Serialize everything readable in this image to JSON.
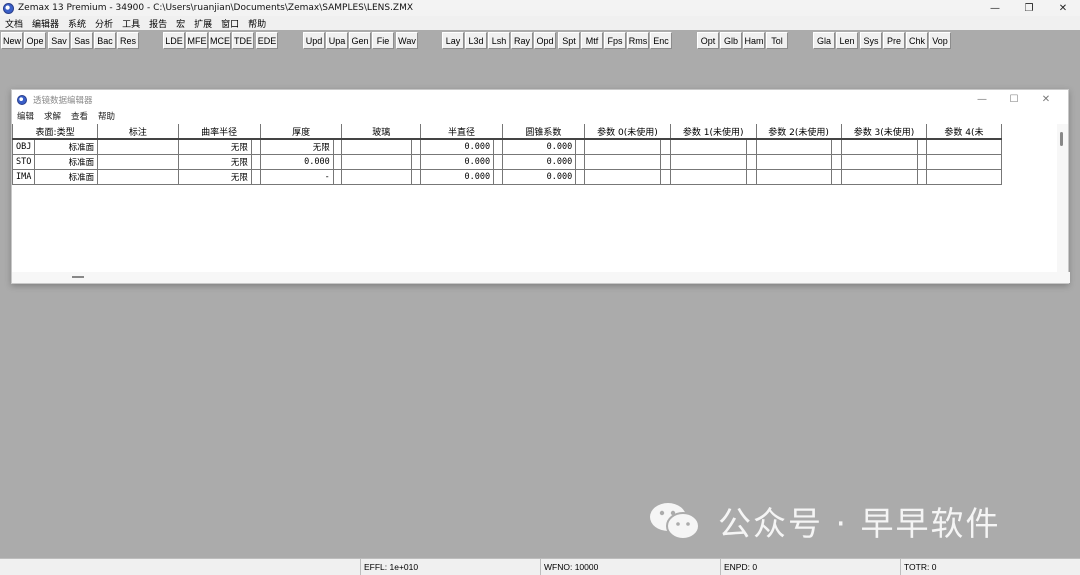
{
  "window": {
    "title": "Zemax 13 Premium - 34900 - C:\\Users\\ruanjian\\Documents\\Zemax\\SAMPLES\\LENS.ZMX",
    "controls": [
      "—",
      "❐",
      "✕"
    ]
  },
  "menu": [
    "文档",
    "编辑器",
    "系统",
    "分析",
    "工具",
    "报告",
    "宏",
    "扩展",
    "窗口",
    "帮助"
  ],
  "toolbar": [
    "New",
    "Ope",
    "Sav",
    "Sas",
    "Bac",
    "Res",
    "LDE",
    "MFE",
    "MCE",
    "TDE",
    "EDE",
    "Upd",
    "Upa",
    "Gen",
    "Fie",
    "Wav",
    "Lay",
    "L3d",
    "Lsh",
    "Ray",
    "Opd",
    "Spt",
    "Mtf",
    "Fps",
    "Rms",
    "Enc",
    "Opt",
    "Glb",
    "Ham",
    "Tol",
    "Gla",
    "Len",
    "Sys",
    "Pre",
    "Chk",
    "Vop"
  ],
  "editor": {
    "title": "透镜数据编辑器",
    "controls": [
      "—",
      "☐",
      "✕"
    ],
    "menu": [
      "编辑",
      "求解",
      "查看",
      "帮助"
    ],
    "columns": [
      "表面:类型",
      "标注",
      "曲率半径",
      "厚度",
      "玻璃",
      "半直径",
      "圆锥系数",
      "参数 0(未使用)",
      "参数 1(未使用)",
      "参数 2(未使用)",
      "参数 3(未使用)",
      "参数 4(未"
    ],
    "rows": [
      {
        "surf": "OBJ",
        "type": "标准面",
        "comment": "",
        "radius": "无限",
        "thickness": "无限",
        "glass": "",
        "semi_dia": "0.000",
        "conic": "0.000"
      },
      {
        "surf": "STO",
        "type": "标准面",
        "comment": "",
        "radius": "无限",
        "thickness": "0.000",
        "glass": "",
        "semi_dia": "0.000",
        "conic": "0.000"
      },
      {
        "surf": "IMA",
        "type": "标准面",
        "comment": "",
        "radius": "无限",
        "thickness": "-",
        "glass": "",
        "semi_dia": "0.000",
        "conic": "0.000"
      }
    ]
  },
  "watermark": "公众号 · 早早软件",
  "status": {
    "effl": "EFFL: 1e+010",
    "wfno": "WFNO: 10000",
    "enpd": "ENPD: 0",
    "totr": "TOTR: 0"
  }
}
